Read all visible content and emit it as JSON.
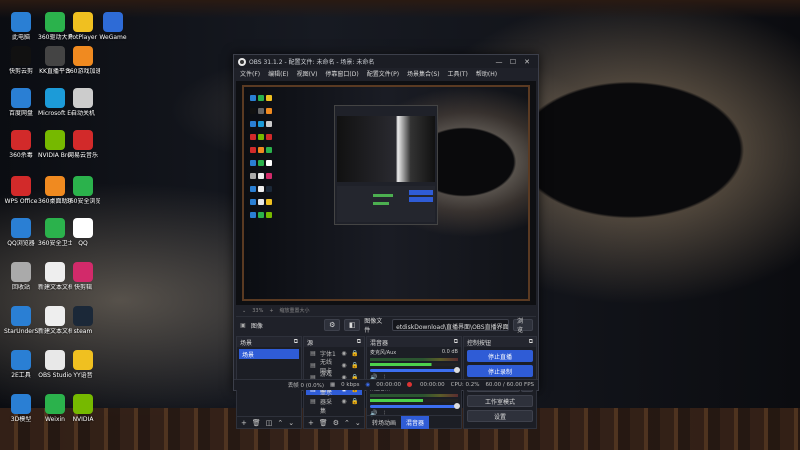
{
  "desktop": {
    "icons": [
      {
        "label": "此电脑",
        "icon": "computer-icon",
        "color": "#2a7fd4"
      },
      {
        "label": "360驱动大师",
        "icon": "driver-master-icon",
        "color": "#2bb24c"
      },
      {
        "label": "PotPlayer",
        "icon": "potplayer-icon",
        "color": "#f0c020"
      },
      {
        "label": "WeGame",
        "icon": "wegame-icon",
        "color": "#2e6bd6"
      },
      {
        "label": "快剪云剪",
        "icon": "capcut-icon",
        "color": "#111111"
      },
      {
        "label": "KK直播平台",
        "icon": "kk-live-icon",
        "color": "#444444"
      },
      {
        "label": "360游戏加速器",
        "icon": "game-accelerator-icon",
        "color": "#f08a20"
      },
      {
        "label": "百度网盘",
        "icon": "baidu-pan-icon",
        "color": "#2a7fd4"
      },
      {
        "label": "Microsoft Edge",
        "icon": "edge-icon",
        "color": "#1c9bd8"
      },
      {
        "label": "自动关机",
        "icon": "shutdown-icon",
        "color": "#cccccc"
      },
      {
        "label": "360杀毒",
        "icon": "antivirus-icon",
        "color": "#d22a2a"
      },
      {
        "label": "NVIDIA Broadcast",
        "icon": "nvidia-broadcast-icon",
        "color": "#76b900"
      },
      {
        "label": "网易云音乐",
        "icon": "netease-music-icon",
        "color": "#d22a2a"
      },
      {
        "label": "WPS Office",
        "icon": "wps-icon",
        "color": "#d22a2a"
      },
      {
        "label": "360桌面助手",
        "icon": "desktop-helper-icon",
        "color": "#f08a20"
      },
      {
        "label": "360安全浏览器",
        "icon": "360-browser-icon",
        "color": "#2bb24c"
      },
      {
        "label": "QQ浏览器",
        "icon": "qq-browser-icon",
        "color": "#2a7fd4"
      },
      {
        "label": "360安全卫士",
        "icon": "360-guard-icon",
        "color": "#2bb24c"
      },
      {
        "label": "QQ",
        "icon": "qq-icon",
        "color": "#ffffff"
      },
      {
        "label": "回收站",
        "icon": "recycle-bin-icon",
        "color": "#aaaaaa"
      },
      {
        "label": "新建文本文档 (2)",
        "icon": "text-doc-icon",
        "color": "#eeeeee"
      },
      {
        "label": "快剪辑",
        "icon": "kuaijianji-icon",
        "color": "#d22a6a"
      },
      {
        "label": "StarUnderSrd",
        "icon": "app-icon",
        "color": "#2a7fd4"
      },
      {
        "label": "新建文本文档 (4)",
        "icon": "text-doc-icon",
        "color": "#eeeeee"
      },
      {
        "label": "steam",
        "icon": "steam-icon",
        "color": "#1b2838"
      },
      {
        "label": "2E工具",
        "icon": "tool-icon",
        "color": "#2a7fd4"
      },
      {
        "label": "OBS Studio",
        "icon": "obs-icon",
        "color": "#e8e8e8"
      },
      {
        "label": "YY语音",
        "icon": "yy-icon",
        "color": "#f0c020"
      },
      {
        "label": "3D模型",
        "icon": "3d-icon",
        "color": "#2a7fd4"
      },
      {
        "label": "Weixin",
        "icon": "wechat-icon",
        "color": "#2bb24c"
      },
      {
        "label": "NVIDIA",
        "icon": "nvidia-icon",
        "color": "#76b900"
      }
    ]
  },
  "obs": {
    "title": "OBS 31.1.2 - 配置文件: 未命名 - 场景: 未命名",
    "menu": [
      "文件(F)",
      "编辑(E)",
      "视图(V)",
      "停靠窗口(D)",
      "配置文件(P)",
      "场景集合(S)",
      "工具(T)",
      "帮助(H)"
    ],
    "toolbar": {
      "zoom": "33%",
      "scale_label": "缩放重置大小"
    },
    "source_bar": {
      "type_label": "图像",
      "file_label": "图像文件",
      "file_value": "etdiskDownload\\直播界面\\OBS直播界面.png",
      "browse": "浏览"
    },
    "scenes": {
      "header": "场景",
      "items": [
        "场景"
      ]
    },
    "sources": {
      "header": "源",
      "items": [
        {
          "name": "字体1",
          "selected": false
        },
        {
          "name": "无线网卡",
          "selected": false
        },
        {
          "name": "游戏采集",
          "selected": false
        },
        {
          "name": "图像",
          "selected": true
        },
        {
          "name": "显示器采集",
          "selected": false
        }
      ]
    },
    "mixer": {
      "header": "混音器",
      "channels": [
        {
          "name": "麦克风/Aux",
          "db": "0.0 dB",
          "level": 0.7
        },
        {
          "name": "桌面音频",
          "db": "-0.8 dB",
          "level": 0.6
        }
      ],
      "tabs": [
        "转场动画",
        "混音器"
      ]
    },
    "controls": {
      "header": "控制按钮",
      "buttons": [
        "停止直播",
        "停止录制",
        "启动虚拟摄像机",
        "工作室模式",
        "设置"
      ]
    },
    "status": {
      "dropped": "丢帧 0 (0.0%)",
      "kbps": "0 kbps",
      "stream_time": "00:00:00",
      "rec_time": "00:00:00",
      "cpu": "CPU: 0.2%",
      "fps": "60.00 / 60.00 FPS"
    },
    "accent": "#2f5cd6"
  }
}
